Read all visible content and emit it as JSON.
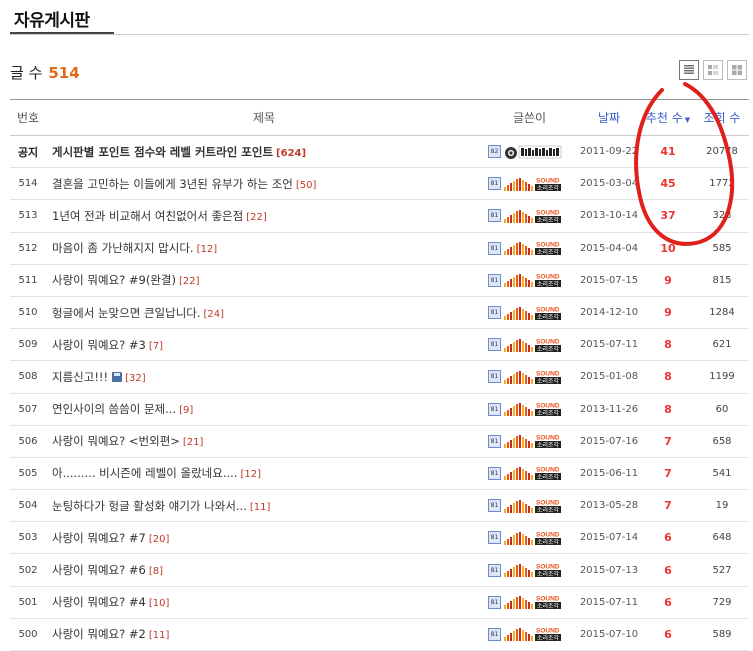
{
  "board": {
    "title": "자유게시판",
    "count_label": "글 수",
    "count": "514"
  },
  "headers": {
    "no": "번호",
    "subject": "제목",
    "writer": "글쓴이",
    "date": "날짜",
    "recommend": "추천 수",
    "views": "조회 수"
  },
  "posts": [
    {
      "no": "공지",
      "subject": "게시판별 포인트 점수와 레벨 커트라인 포인트",
      "comments": "[624]",
      "notice": true,
      "level": "82",
      "writer_logo": "헝글아재비 웃음",
      "date": "2011-09-22",
      "recommend": "41",
      "views": "20778"
    },
    {
      "no": "514",
      "subject": "결혼을 고민하는 이들에게 3년된 유부가 하는 조언",
      "comments": "[50]",
      "level": "81",
      "writer_logo": "SOUND 소리조각",
      "date": "2015-03-04",
      "recommend": "45",
      "views": "1772"
    },
    {
      "no": "513",
      "subject": "1년여 전과 비교해서 여친없어서 좋은점",
      "comments": "[22]",
      "level": "81",
      "writer_logo": "SOUND 소리조각",
      "date": "2013-10-14",
      "recommend": "37",
      "views": "323"
    },
    {
      "no": "512",
      "subject": "마음이 좀 가난해지지 맙시다.",
      "comments": "[12]",
      "level": "81",
      "writer_logo": "SOUND 소리조각",
      "date": "2015-04-04",
      "recommend": "10",
      "views": "585"
    },
    {
      "no": "511",
      "subject": "사랑이 뭐예요? #9(완결)",
      "comments": "[22]",
      "level": "81",
      "writer_logo": "SOUND 소리조각",
      "date": "2015-07-15",
      "recommend": "9",
      "views": "815"
    },
    {
      "no": "510",
      "subject": "헝글에서 눈맞으면 큰일납니다.",
      "comments": "[24]",
      "level": "81",
      "writer_logo": "SOUND 소리조각",
      "date": "2014-12-10",
      "recommend": "9",
      "views": "1284"
    },
    {
      "no": "509",
      "subject": "사랑이 뭐예요? #3",
      "comments": "[7]",
      "level": "81",
      "writer_logo": "SOUND 소리조각",
      "date": "2015-07-11",
      "recommend": "8",
      "views": "621"
    },
    {
      "no": "508",
      "subject": "지름신고!!!",
      "comments": "[32]",
      "has_file": true,
      "level": "81",
      "writer_logo": "SOUND 소리조각",
      "date": "2015-01-08",
      "recommend": "8",
      "views": "1199"
    },
    {
      "no": "507",
      "subject": "연인사이의 씀씀이 문제...",
      "comments": "[9]",
      "level": "81",
      "writer_logo": "SOUND 소리조각",
      "date": "2013-11-26",
      "recommend": "8",
      "views": "60"
    },
    {
      "no": "506",
      "subject": "사랑이 뭐예요? <번외편>",
      "comments": "[21]",
      "level": "81",
      "writer_logo": "SOUND 소리조각",
      "date": "2015-07-16",
      "recommend": "7",
      "views": "658"
    },
    {
      "no": "505",
      "subject": "아......... 비시즌에 레벨이 올랐네요....",
      "comments": "[12]",
      "level": "81",
      "writer_logo": "SOUND 소리조각",
      "date": "2015-06-11",
      "recommend": "7",
      "views": "541"
    },
    {
      "no": "504",
      "subject": "눈팅하다가 헝글 활성화 얘기가 나와서...",
      "comments": "[11]",
      "level": "81",
      "writer_logo": "SOUND 소리조각",
      "date": "2013-05-28",
      "recommend": "7",
      "views": "19"
    },
    {
      "no": "503",
      "subject": "사랑이 뭐예요? #7",
      "comments": "[20]",
      "level": "81",
      "writer_logo": "SOUND 소리조각",
      "date": "2015-07-14",
      "recommend": "6",
      "views": "648"
    },
    {
      "no": "502",
      "subject": "사랑이 뭐예요? #6",
      "comments": "[8]",
      "level": "81",
      "writer_logo": "SOUND 소리조각",
      "date": "2015-07-13",
      "recommend": "6",
      "views": "527"
    },
    {
      "no": "501",
      "subject": "사랑이 뭐예요? #4",
      "comments": "[10]",
      "level": "81",
      "writer_logo": "SOUND 소리조각",
      "date": "2015-07-11",
      "recommend": "6",
      "views": "729"
    },
    {
      "no": "500",
      "subject": "사랑이 뭐예요? #2",
      "comments": "[11]",
      "level": "81",
      "writer_logo": "SOUND 소리조각",
      "date": "2015-07-10",
      "recommend": "6",
      "views": "589"
    }
  ],
  "colors": {
    "accent": "#e06a1a",
    "recommend": "#ee3333",
    "header_link": "#3a5fcd",
    "annotation": "#e0201a"
  },
  "icons": {
    "view_list": "list-view-icon",
    "view_thumb": "thumbnail-view-icon",
    "view_grid": "grid-view-icon"
  }
}
